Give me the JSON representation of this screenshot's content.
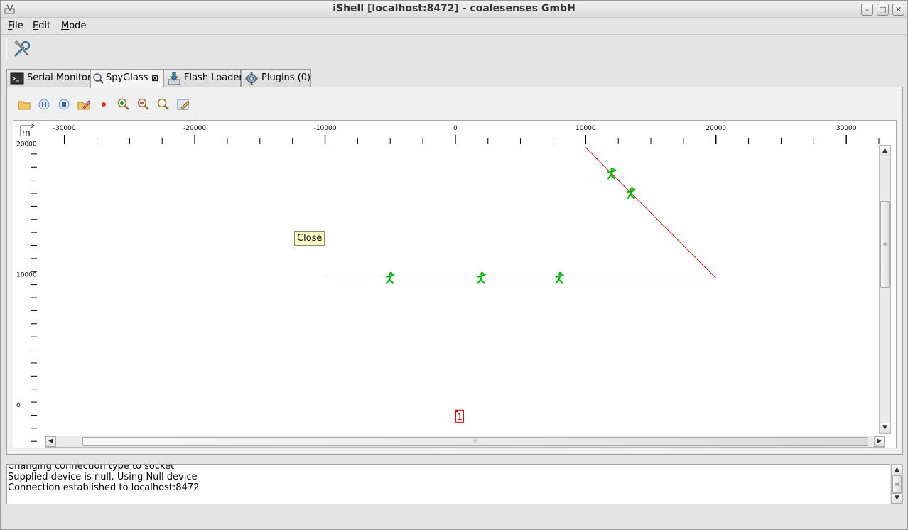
{
  "window": {
    "title": "iShell [localhost:8472] - coalesenses GmbH"
  },
  "menu": [
    {
      "mnemonic": "F",
      "rest": "ile"
    },
    {
      "mnemonic": "E",
      "rest": "dit"
    },
    {
      "mnemonic": "M",
      "rest": "ode"
    }
  ],
  "tabs": [
    {
      "label": "Serial Monitor",
      "icon": "terminal-icon"
    },
    {
      "label": "SpyGlass",
      "icon": "magnifier-icon",
      "closable": true
    },
    {
      "label": "Flash Loader",
      "icon": "flash-download-icon"
    },
    {
      "label": "Plugins (0)",
      "icon": "gear-icon"
    }
  ],
  "active_tab": "SpyGlass",
  "spyglass_toolbar": [
    "open-folder-icon",
    "pause-icon",
    "stop-icon",
    "edit-folder-icon",
    "record-icon",
    "zoom-in-icon",
    "zoom-out-icon",
    "zoom-fit-icon",
    "settings-icon"
  ],
  "chart_data": {
    "type": "scatter",
    "title": "",
    "unit_label": "m",
    "x_ticks": [
      "-30000",
      "-20000",
      "-10000",
      "0",
      "10000",
      "20000",
      "30000"
    ],
    "y_ticks": [
      "20000",
      "10000",
      "0"
    ],
    "xlim": [
      -32000,
      32500
    ],
    "ylim": [
      -2000,
      20200
    ],
    "lines": [
      {
        "color": "#cc0000",
        "points": [
          [
            -10000,
            10000
          ],
          [
            20000,
            10000
          ],
          [
            10000,
            20000
          ]
        ]
      }
    ],
    "nodes": [
      {
        "x": -5000,
        "y": 10000
      },
      {
        "x": 2000,
        "y": 10000
      },
      {
        "x": 8000,
        "y": 10000
      },
      {
        "x": 12000,
        "y": 18000
      },
      {
        "x": 13500,
        "y": 16500
      }
    ],
    "node_color": "#22cc22",
    "marker": {
      "label": "1",
      "x": 300,
      "y": 0,
      "color": "#cc0000"
    }
  },
  "tooltip": "Close",
  "console": {
    "lines": [
      "Changing connection type to socket",
      "Supplied device is null. Using Null device",
      "Connection established to localhost:8472"
    ]
  }
}
